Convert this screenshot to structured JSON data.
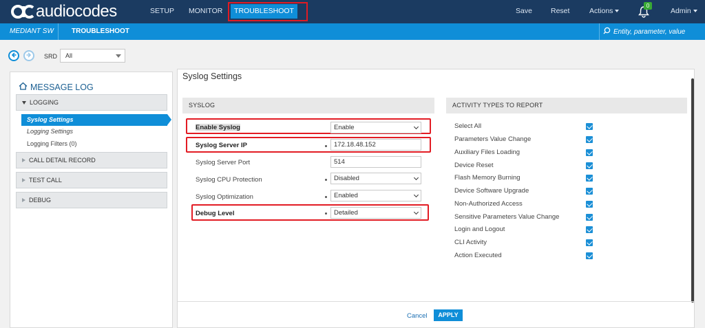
{
  "header": {
    "brand": "audiocodes",
    "nav": [
      "SETUP",
      "MONITOR",
      "TROUBLESHOOT"
    ],
    "active_nav": "TROUBLESHOOT",
    "save": "Save",
    "reset": "Reset",
    "actions": "Actions",
    "alarm_count": "0",
    "user": "Admin"
  },
  "subbar": {
    "device": "MEDIANT SW",
    "section": "TROUBLESHOOT",
    "search_placeholder": "Entity, parameter, value"
  },
  "srd": {
    "label": "SRD",
    "value": "All"
  },
  "sidebar": {
    "title": "MESSAGE LOG",
    "groups": [
      {
        "label": "LOGGING",
        "expanded": true,
        "items": [
          "Syslog Settings",
          "Logging Settings",
          "Logging Filters (0)"
        ]
      },
      {
        "label": "CALL DETAIL RECORD",
        "expanded": false
      },
      {
        "label": "TEST CALL",
        "expanded": false
      },
      {
        "label": "DEBUG",
        "expanded": false
      }
    ]
  },
  "main": {
    "title": "Syslog Settings",
    "syslog_group": "SYSLOG",
    "fields": [
      {
        "label": "Enable Syslog",
        "value": "Enable",
        "type": "select"
      },
      {
        "label": "Syslog Server IP",
        "value": "172.18.48.152",
        "type": "text"
      },
      {
        "label": "Syslog Server Port",
        "value": "514",
        "type": "text"
      },
      {
        "label": "Syslog CPU Protection",
        "value": "Disabled",
        "type": "select"
      },
      {
        "label": "Syslog Optimization",
        "value": "Enabled",
        "type": "select"
      },
      {
        "label": "Debug Level",
        "value": "Detailed",
        "type": "select"
      }
    ],
    "activity_group": "ACTIVITY TYPES TO REPORT",
    "activities": [
      {
        "label": "Select All",
        "checked": true
      },
      {
        "label": "Parameters Value Change",
        "checked": true
      },
      {
        "label": "Auxiliary Files Loading",
        "checked": true
      },
      {
        "label": "Device Reset",
        "checked": true
      },
      {
        "label": "Flash Memory Burning",
        "checked": true
      },
      {
        "label": "Device Software Upgrade",
        "checked": true
      },
      {
        "label": "Non-Authorized Access",
        "checked": true
      },
      {
        "label": "Sensitive Parameters Value Change",
        "checked": true
      },
      {
        "label": "Login and Logout",
        "checked": true
      },
      {
        "label": "CLI Activity",
        "checked": true
      },
      {
        "label": "Action Executed",
        "checked": true
      }
    ],
    "cancel": "Cancel",
    "apply": "APPLY"
  },
  "colors": {
    "header_bg": "#1b3b61",
    "accent": "#0f8ed8",
    "highlight_box": "#e21b23"
  }
}
